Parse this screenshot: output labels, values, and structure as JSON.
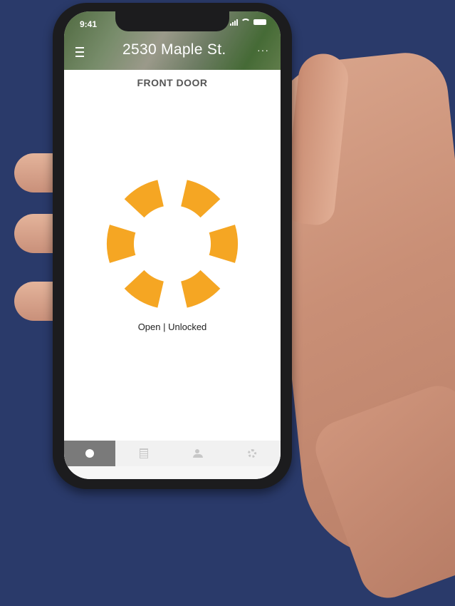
{
  "status_bar": {
    "time": "9:41"
  },
  "header": {
    "address": "2530 Maple St.",
    "menu_icon": "hamburger-menu-icon",
    "more_icon": "more-dots-icon",
    "more_glyph": "···"
  },
  "device": {
    "name": "FRONT DOOR"
  },
  "lock": {
    "status_text": "Open | Unlocked",
    "accent_color": "#f5a623",
    "segments": 6
  },
  "tabbar": {
    "tabs": [
      {
        "name": "lock",
        "icon": "dot-icon",
        "active": true
      },
      {
        "name": "history",
        "icon": "list-icon",
        "active": false
      },
      {
        "name": "users",
        "icon": "users-icon",
        "active": false
      },
      {
        "name": "settings",
        "icon": "gear-icon",
        "active": false
      }
    ]
  },
  "colors": {
    "background": "#2a3a6a",
    "phone_frame": "#1c1c1e",
    "tab_active": "#7a7a7a"
  }
}
